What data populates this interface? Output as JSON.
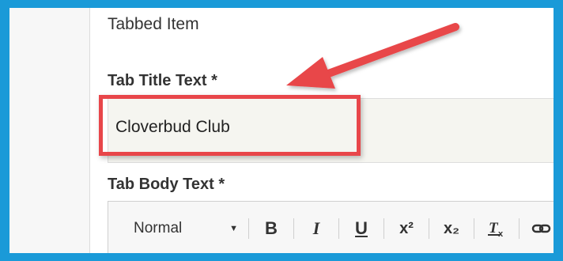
{
  "section": {
    "title": "Tabbed Item"
  },
  "fields": {
    "tab_title": {
      "label": "Tab Title Text *",
      "value": "Cloverbud Club"
    },
    "tab_body": {
      "label": "Tab Body Text *"
    }
  },
  "editor": {
    "format_value": "Normal",
    "toolbar": {
      "bold": "B",
      "italic": "I",
      "underline": "U",
      "superscript": "x²",
      "subscript": "x₂",
      "clear_format": "Tx"
    }
  },
  "annotation": {
    "color": "#e8464a"
  },
  "theme": {
    "border": "#1a9ad8"
  }
}
